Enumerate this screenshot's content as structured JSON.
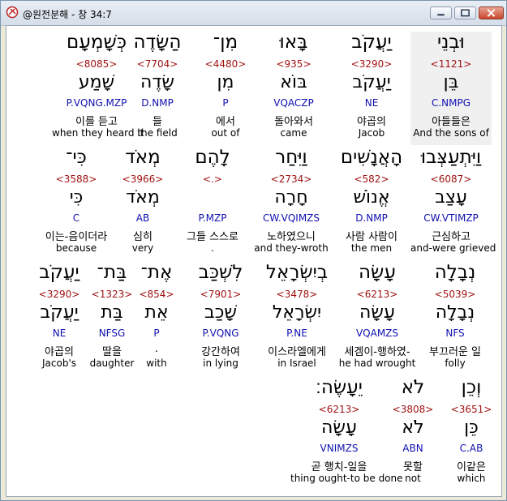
{
  "window": {
    "title": "@원전분해 - 창 34:7"
  },
  "words": [
    {
      "heb": "וּבְנֵי",
      "strong": "<1121>",
      "lemma": "בֵּן",
      "morph": "C.NMPG",
      "kor": "아들들은",
      "eng": "And the sons of",
      "highlight": true
    },
    {
      "heb": "יַעֲקֹב",
      "strong": "<3290>",
      "lemma": "יַעֲקֹב",
      "morph": "NE",
      "kor": "야곱의",
      "eng": "Jacob"
    },
    {
      "heb": "בָּאוּ",
      "strong": "<935>",
      "lemma": "בּוֹא",
      "morph": "VQACZP",
      "kor": "돌아와서",
      "eng": "came"
    },
    {
      "heb": "מִן־",
      "strong": "<4480>",
      "lemma": "מִן",
      "morph": "P",
      "kor": "에서",
      "eng": "out of"
    },
    {
      "heb": "הַשָּׂדֶה",
      "strong": "<7704>",
      "lemma": "שָׂדֶה",
      "morph": "D.NMP",
      "kor": "들",
      "eng": "the field"
    },
    {
      "heb": "כְּשָׁמְעָם",
      "strong": "<8085>",
      "lemma": "שָׁמַע",
      "morph": "P.VQNG.MZP",
      "kor": "이를 듣고",
      "eng": "when they heard it"
    },
    {
      "heb": "וַיִּתְעַצְּבוּ",
      "strong": "<6087>",
      "lemma": "עָצַב",
      "morph": "CW.VTIMZP",
      "kor": "근심하고",
      "eng": "and-were grieved"
    },
    {
      "heb": "הָאֲנָשִׁים",
      "strong": "<582>",
      "lemma": "אֱנוֹשׁ",
      "morph": "D.NMP",
      "kor": "사람 사람이",
      "eng": "the men"
    },
    {
      "heb": "וַיִּחַר",
      "strong": "<2734>",
      "lemma": "חָרָה",
      "morph": "CW.VQIMZS",
      "kor": "노하였으니",
      "eng": "and they-wroth"
    },
    {
      "heb": "לָהֶם",
      "strong": "<.>",
      "lemma": "",
      "morph": "P.MZP",
      "kor": "그들 스스로",
      "eng": "."
    },
    {
      "heb": "מְאֹד",
      "strong": "<3966>",
      "lemma": "מְאֹד",
      "morph": "AB",
      "kor": "심히",
      "eng": "very"
    },
    {
      "heb": "כִּי־",
      "strong": "<3588>",
      "lemma": "כִּי",
      "morph": "C",
      "kor": "이는-음이더라",
      "eng": "because"
    },
    {
      "heb": "נְבָלָה",
      "strong": "<5039>",
      "lemma": "נְבָלָה",
      "morph": "NFS",
      "kor": "부끄러운 일",
      "eng": "folly"
    },
    {
      "heb": "עָשָׂה",
      "strong": "<6213>",
      "lemma": "עָשָׂה",
      "morph": "VQAMZS",
      "kor": "세겜이-행하였-",
      "eng": "he had wrought"
    },
    {
      "heb": "בְיִשְׂרָאֵל",
      "strong": "<3478>",
      "lemma": "יִשְׂרָאֵל",
      "morph": "P.NE",
      "kor": "이스라엘에게",
      "eng": "in Israel"
    },
    {
      "heb": "לִשְׁכַּב",
      "strong": "<7901>",
      "lemma": "שָׁכַב",
      "morph": "P.VQNG",
      "kor": "강간하여",
      "eng": "in lying"
    },
    {
      "heb": "אֶת־",
      "strong": "<854>",
      "lemma": "אֵת",
      "morph": "P",
      "kor": ".",
      "eng": "with"
    },
    {
      "heb": "בַּת־",
      "strong": "<1323>",
      "lemma": "בַּת",
      "morph": "NFSG",
      "kor": "딸을",
      "eng": "daughter"
    },
    {
      "heb": "יַעֲקֹב",
      "strong": "<3290>",
      "lemma": "יַעֲקֹב",
      "morph": "NE",
      "kor": "야곱의",
      "eng": "Jacob's"
    },
    {
      "heb": "וְכֵן",
      "strong": "<3651>",
      "lemma": "כֵּן",
      "morph": "C.AB",
      "kor": "이같은",
      "eng": "which"
    },
    {
      "heb": "לֹא",
      "strong": "<3808>",
      "lemma": "לֹא",
      "morph": "ABN",
      "kor": "못할",
      "eng": "not"
    },
    {
      "heb": "יֵעָשֶׂה׃",
      "strong": "<6213>",
      "lemma": "עָשָׂה",
      "morph": "VNIMZS",
      "kor": "곧 행치-일을",
      "eng": "thing ought-to be done"
    }
  ]
}
